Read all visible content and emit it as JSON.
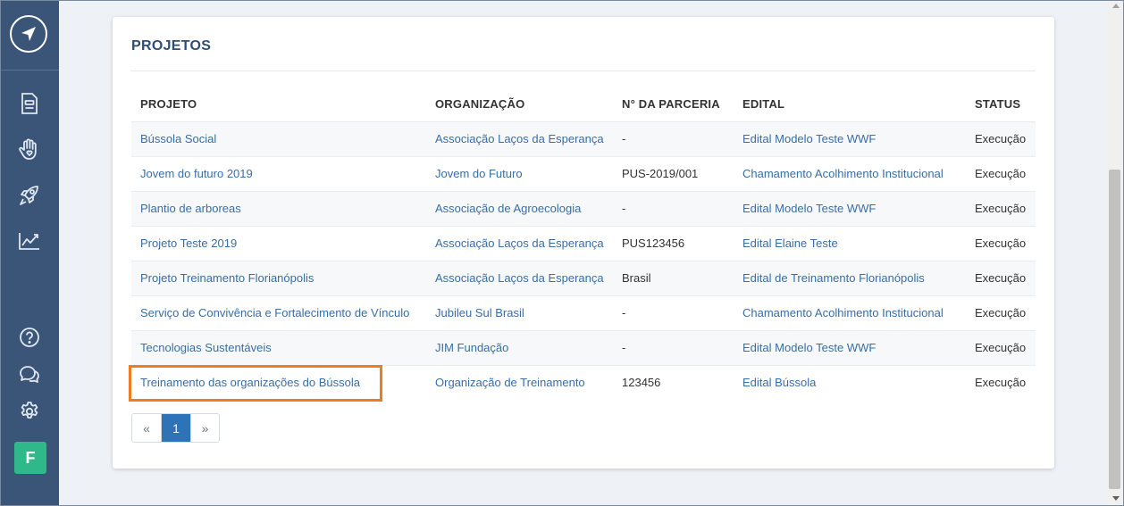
{
  "sidebar": {
    "logo_icon": "compass-logo-icon",
    "nav_icons": [
      "document-icon",
      "hand-heart-icon",
      "rocket-icon",
      "chart-trend-icon"
    ],
    "bottom_icons": [
      "help-icon",
      "chat-icon",
      "gear-icon"
    ],
    "avatar_letter": "F"
  },
  "card": {
    "title": "PROJETOS"
  },
  "table": {
    "headers": {
      "projeto": "PROJETO",
      "organizacao": "ORGANIZAÇÃO",
      "parceria": "N° DA PARCERIA",
      "edital": "EDITAL",
      "status": "STATUS"
    },
    "rows": [
      {
        "projeto": "Bússola Social",
        "organizacao": "Associação Laços da Esperança",
        "parceria": "-",
        "edital": "Edital Modelo Teste WWF",
        "status": "Execução"
      },
      {
        "projeto": "Jovem do futuro 2019",
        "organizacao": "Jovem do Futuro",
        "parceria": "PUS-2019/001",
        "edital": "Chamamento Acolhimento Institucional",
        "status": "Execução"
      },
      {
        "projeto": "Plantio de arboreas",
        "organizacao": "Associação de Agroecologia",
        "parceria": "-",
        "edital": "Edital Modelo Teste WWF",
        "status": "Execução"
      },
      {
        "projeto": "Projeto Teste 2019",
        "organizacao": "Associação Laços da Esperança",
        "parceria": "PUS123456",
        "edital": "Edital Elaine Teste",
        "status": "Execução"
      },
      {
        "projeto": "Projeto Treinamento Florianópolis",
        "organizacao": "Associação Laços da Esperança",
        "parceria": "Brasil",
        "edital": "Edital de Treinamento Florianópolis",
        "status": "Execução"
      },
      {
        "projeto": "Serviço de Convivência e Fortalecimento de Vínculo",
        "organizacao": "Jubileu Sul Brasil",
        "parceria": "-",
        "edital": "Chamamento Acolhimento Institucional",
        "status": "Execução"
      },
      {
        "projeto": "Tecnologias Sustentáveis",
        "organizacao": "JIM Fundação",
        "parceria": "-",
        "edital": "Edital Modelo Teste WWF",
        "status": "Execução"
      },
      {
        "projeto": "Treinamento das organizações do Bússola",
        "organizacao": "Organização de Treinamento",
        "parceria": "123456",
        "edital": "Edital Bússola",
        "status": "Execução"
      }
    ]
  },
  "pagination": {
    "prev": "«",
    "current": "1",
    "next": "»"
  },
  "colors": {
    "sidebar_bg": "#3a5577",
    "link": "#3a6ea5",
    "title": "#2e4f73",
    "highlight": "#f07c22",
    "avatar_bg": "#2fb889",
    "page_active": "#2e72b8"
  }
}
